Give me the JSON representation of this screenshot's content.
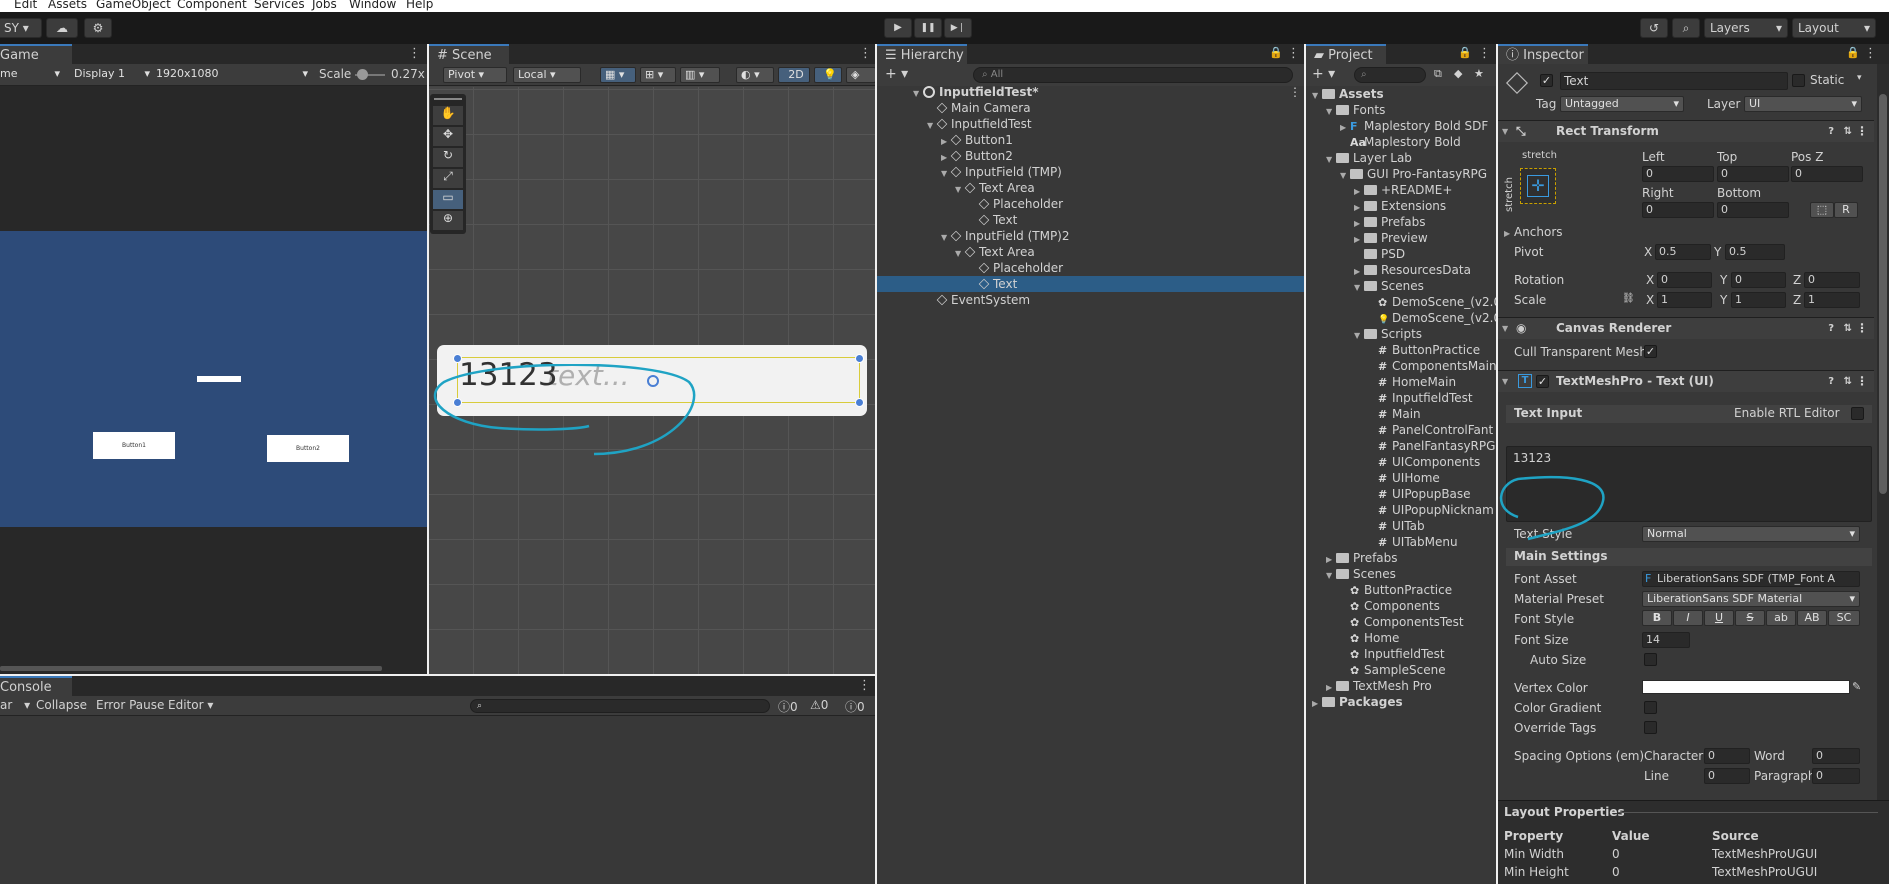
{
  "menubar": {
    "items": [
      "Edit",
      "Assets",
      "GameObject",
      "Component",
      "Services",
      "Jobs",
      "Window",
      "Help"
    ]
  },
  "toolbar": {
    "account": "SY",
    "layers": "Layers",
    "layout": "Layout"
  },
  "game": {
    "tab": "Game",
    "mode": "me",
    "display": "Display 1",
    "resolution": "1920x1080",
    "scale_label": "Scale",
    "scale_value": "0.27x",
    "button1": "Button1",
    "button2": "Button2"
  },
  "scene": {
    "tab": "Scene",
    "pivot": "Pivot",
    "local": "Local",
    "mode2d": "2D",
    "input_text": "13123",
    "placeholder": "text..."
  },
  "hierarchy": {
    "tab": "Hierarchy",
    "search_placeholder": "All",
    "items": [
      {
        "label": "InputfieldTest*",
        "indent": 0
      },
      {
        "label": "Main Camera",
        "indent": 1
      },
      {
        "label": "InputfieldTest",
        "indent": 1
      },
      {
        "label": "Button1",
        "indent": 2
      },
      {
        "label": "Button2",
        "indent": 2
      },
      {
        "label": "InputField (TMP)",
        "indent": 2
      },
      {
        "label": "Text Area",
        "indent": 3
      },
      {
        "label": "Placeholder",
        "indent": 4
      },
      {
        "label": "Text",
        "indent": 4
      },
      {
        "label": "InputField (TMP)2",
        "indent": 2
      },
      {
        "label": "Text Area",
        "indent": 3
      },
      {
        "label": "Placeholder",
        "indent": 4
      },
      {
        "label": "Text",
        "indent": 4
      },
      {
        "label": "EventSystem",
        "indent": 1
      }
    ]
  },
  "project": {
    "tab": "Project",
    "items": [
      {
        "label": "Assets",
        "indent": 0,
        "icon": "folder"
      },
      {
        "label": "Fonts",
        "indent": 1,
        "icon": "folder"
      },
      {
        "label": "Maplestory Bold SDF",
        "indent": 2,
        "icon": "font-asset"
      },
      {
        "label": "Maplestory Bold",
        "indent": 2,
        "icon": "font"
      },
      {
        "label": "Layer Lab",
        "indent": 1,
        "icon": "folder"
      },
      {
        "label": "GUI Pro-FantasyRPG",
        "indent": 2,
        "icon": "folder"
      },
      {
        "label": "+README+",
        "indent": 3,
        "icon": "folder"
      },
      {
        "label": "Extensions",
        "indent": 3,
        "icon": "folder"
      },
      {
        "label": "Prefabs",
        "indent": 3,
        "icon": "folder"
      },
      {
        "label": "Preview",
        "indent": 3,
        "icon": "folder"
      },
      {
        "label": "PSD",
        "indent": 3,
        "icon": "folder"
      },
      {
        "label": "ResourcesData",
        "indent": 3,
        "icon": "folder"
      },
      {
        "label": "Scenes",
        "indent": 3,
        "icon": "folder"
      },
      {
        "label": "DemoScene_(v2.0",
        "indent": 4,
        "icon": "scene"
      },
      {
        "label": "DemoScene_(v2.0",
        "indent": 4,
        "icon": "lighting"
      },
      {
        "label": "Scripts",
        "indent": 3,
        "icon": "folder"
      },
      {
        "label": "ButtonPractice",
        "indent": 4,
        "icon": "script"
      },
      {
        "label": "ComponentsMain",
        "indent": 4,
        "icon": "script"
      },
      {
        "label": "HomeMain",
        "indent": 4,
        "icon": "script"
      },
      {
        "label": "InputfieldTest",
        "indent": 4,
        "icon": "script"
      },
      {
        "label": "Main",
        "indent": 4,
        "icon": "script"
      },
      {
        "label": "PanelControlFant",
        "indent": 4,
        "icon": "script"
      },
      {
        "label": "PanelFantasyRPG",
        "indent": 4,
        "icon": "script"
      },
      {
        "label": "UIComponents",
        "indent": 4,
        "icon": "script"
      },
      {
        "label": "UIHome",
        "indent": 4,
        "icon": "script"
      },
      {
        "label": "UIPopupBase",
        "indent": 4,
        "icon": "script"
      },
      {
        "label": "UIPopupNicknam",
        "indent": 4,
        "icon": "script"
      },
      {
        "label": "UITab",
        "indent": 4,
        "icon": "script"
      },
      {
        "label": "UITabMenu",
        "indent": 4,
        "icon": "script"
      },
      {
        "label": "Prefabs",
        "indent": 1,
        "icon": "folder"
      },
      {
        "label": "Scenes",
        "indent": 1,
        "icon": "folder"
      },
      {
        "label": "ButtonPractice",
        "indent": 2,
        "icon": "scene"
      },
      {
        "label": "Components",
        "indent": 2,
        "icon": "scene"
      },
      {
        "label": "ComponentsTest",
        "indent": 2,
        "icon": "scene"
      },
      {
        "label": "Home",
        "indent": 2,
        "icon": "scene"
      },
      {
        "label": "InputfieldTest",
        "indent": 2,
        "icon": "scene"
      },
      {
        "label": "SampleScene",
        "indent": 2,
        "icon": "scene"
      },
      {
        "label": "TextMesh Pro",
        "indent": 1,
        "icon": "folder"
      },
      {
        "label": "Packages",
        "indent": 0,
        "icon": "folder"
      }
    ]
  },
  "console": {
    "tab": "Console",
    "clear": "ar",
    "collapse": "Collapse",
    "error_pause": "Error Pause",
    "editor": "Editor",
    "counts": [
      "0",
      "0",
      "0"
    ]
  },
  "inspector": {
    "tab": "Inspector",
    "object_name": "Text",
    "static_label": "Static",
    "tag_label": "Tag",
    "tag_value": "Untagged",
    "layer_label": "Layer",
    "layer_value": "UI",
    "rect_transform": {
      "title": "Rect Transform",
      "stretch": "stretch",
      "left_label": "Left",
      "left": "0",
      "top_label": "Top",
      "top": "0",
      "posz_label": "Pos Z",
      "posz": "0",
      "right_label": "Right",
      "right": "0",
      "bottom_label": "Bottom",
      "bottom": "0",
      "r_button": "R",
      "anchors": "Anchors",
      "pivot_label": "Pivot",
      "pivot_x": "0.5",
      "pivot_y": "0.5",
      "rotation_label": "Rotation",
      "rot_x": "0",
      "rot_y": "0",
      "rot_z": "0",
      "scale_label": "Scale",
      "scale_x": "1",
      "scale_y": "1",
      "scale_z": "1"
    },
    "canvas_renderer": {
      "title": "Canvas Renderer",
      "cull_label": "Cull Transparent Mesh"
    },
    "tmp": {
      "title": "TextMeshPro - Text (UI)",
      "text_input_label": "Text Input",
      "rtl_label": "Enable RTL Editor",
      "text_value": "13123",
      "text_style_label": "Text Style",
      "text_style": "Normal",
      "main_settings": "Main Settings",
      "font_asset_label": "Font Asset",
      "font_asset": "LiberationSans SDF (TMP_Font A",
      "material_label": "Material Preset",
      "material": "LiberationSans SDF Material",
      "font_style_label": "Font Style",
      "font_styles": [
        "B",
        "I",
        "U",
        "S",
        "ab",
        "AB",
        "SC"
      ],
      "font_size_label": "Font Size",
      "font_size": "14",
      "auto_size_label": "Auto Size",
      "vertex_color_label": "Vertex Color",
      "color_gradient_label": "Color Gradient",
      "override_tags_label": "Override Tags",
      "spacing_label": "Spacing Options (em)",
      "character_label": "Character",
      "character": "0",
      "word_label": "Word",
      "word": "0",
      "line_label": "Line",
      "line": "0",
      "paragraph_label": "Paragraph",
      "paragraph": "0"
    },
    "layout": {
      "title": "Layout Properties",
      "headers": [
        "Property",
        "Value",
        "Source"
      ],
      "rows": [
        [
          "Min Width",
          "0",
          "TextMeshProUGUI"
        ],
        [
          "Min Height",
          "0",
          "TextMeshProUGUI"
        ]
      ]
    }
  },
  "colors": {
    "selection": "#2c5d87",
    "accent": "#3a79bb",
    "annotation": "#1fa3c4"
  }
}
